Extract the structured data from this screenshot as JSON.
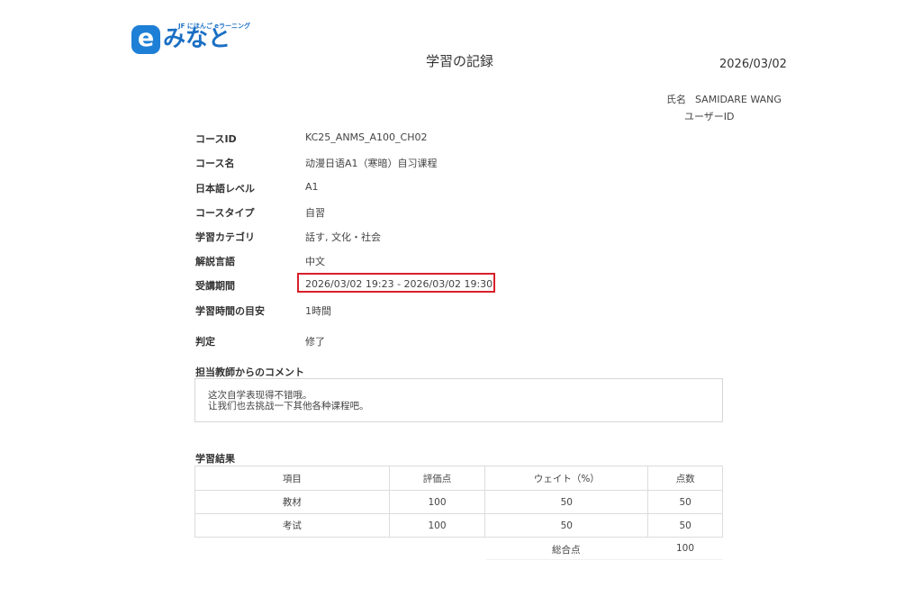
{
  "logo": {
    "tagline": "JF にほんご eラーニング",
    "letter": "e",
    "text": "みなと"
  },
  "header": {
    "title": "学習の記録",
    "date": "2026/03/02"
  },
  "user": {
    "name_label": "氏名",
    "name_value": "SAMIDARE WANG",
    "id_label": "ユーザーID"
  },
  "info": [
    {
      "label": "コースID",
      "value": "KC25_ANMS_A100_CH02"
    },
    {
      "label": "コース名",
      "value": "动漫日语A1（寒暗）自习课程"
    },
    {
      "label": "日本語レベル",
      "value": "A1"
    },
    {
      "label": "コースタイプ",
      "value": "自習"
    },
    {
      "label": "学習カテゴリ",
      "value": "話す, 文化・社会"
    },
    {
      "label": "解説言語",
      "value": "中文"
    },
    {
      "label": "受講期間",
      "value": "2026/03/02 19:23 - 2026/03/02 19:30"
    },
    {
      "label": "学習時間の目安",
      "value": "1時間"
    },
    {
      "label": "判定",
      "value": "修了"
    }
  ],
  "comment": {
    "heading": "担当教師からのコメント",
    "lines": [
      "这次自学表现得不错哦。",
      "让我们也去挑战一下其他各种课程吧。"
    ]
  },
  "results": {
    "heading": "学習結果",
    "columns": [
      "項目",
      "評価点",
      "ウェイト（%）",
      "点数"
    ],
    "rows": [
      [
        "教材",
        "100",
        "50",
        "50"
      ],
      [
        "考试",
        "100",
        "50",
        "50"
      ]
    ],
    "total_label": "総合点",
    "total_value": "100"
  },
  "colors": {
    "brand": "#1e7fd6",
    "highlight_border": "#d8202a",
    "table_border": "#dcdcdc"
  }
}
